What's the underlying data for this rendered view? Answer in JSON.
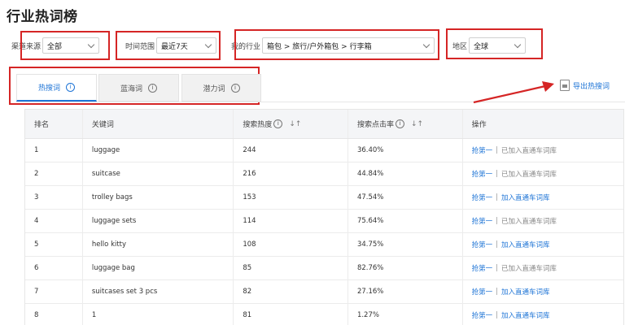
{
  "page": {
    "title": "行业热词榜"
  },
  "filters": {
    "channel": {
      "label": "渠道来源",
      "value": "全部"
    },
    "time": {
      "label": "时间范围",
      "value": "最近7天"
    },
    "industry": {
      "label": "我的行业",
      "value": "箱包 > 旅行/户外箱包 > 行李箱"
    },
    "region": {
      "label": "地区",
      "value": "全球"
    }
  },
  "tabs": [
    {
      "label": "热搜词",
      "active": true
    },
    {
      "label": "蓝海词",
      "active": false
    },
    {
      "label": "潜力词",
      "active": false
    }
  ],
  "export": {
    "label": "导出热搜词",
    "icon": "xls-file-icon"
  },
  "table": {
    "headers": {
      "rank": "排名",
      "keyword": "关键词",
      "heat": "搜索热度",
      "ctr": "搜索点击率",
      "action": "操作"
    },
    "rows": [
      {
        "rank": "1",
        "keyword": "luggage",
        "heat": "244",
        "ctr": "36.40%",
        "first": "抢第一",
        "action": "已加入直通车词库",
        "added": true
      },
      {
        "rank": "2",
        "keyword": "suitcase",
        "heat": "216",
        "ctr": "44.84%",
        "first": "抢第一",
        "action": "已加入直通车词库",
        "added": true
      },
      {
        "rank": "3",
        "keyword": "trolley bags",
        "heat": "153",
        "ctr": "47.54%",
        "first": "抢第一",
        "action": "加入直通车词库",
        "added": false
      },
      {
        "rank": "4",
        "keyword": "luggage sets",
        "heat": "114",
        "ctr": "75.64%",
        "first": "抢第一",
        "action": "已加入直通车词库",
        "added": true
      },
      {
        "rank": "5",
        "keyword": "hello kitty",
        "heat": "108",
        "ctr": "34.75%",
        "first": "抢第一",
        "action": "加入直通车词库",
        "added": false
      },
      {
        "rank": "6",
        "keyword": "luggage bag",
        "heat": "85",
        "ctr": "82.76%",
        "first": "抢第一",
        "action": "已加入直通车词库",
        "added": true
      },
      {
        "rank": "7",
        "keyword": "suitcases set 3 pcs",
        "heat": "82",
        "ctr": "27.16%",
        "first": "抢第一",
        "action": "加入直通车词库",
        "added": false
      },
      {
        "rank": "8",
        "keyword": "1",
        "heat": "81",
        "ctr": "1.27%",
        "first": "抢第一",
        "action": "加入直通车词库",
        "added": false
      }
    ]
  },
  "colors": {
    "accent": "#1e74d6",
    "annotation": "#d52525",
    "header_bg": "#f4f5f7"
  }
}
